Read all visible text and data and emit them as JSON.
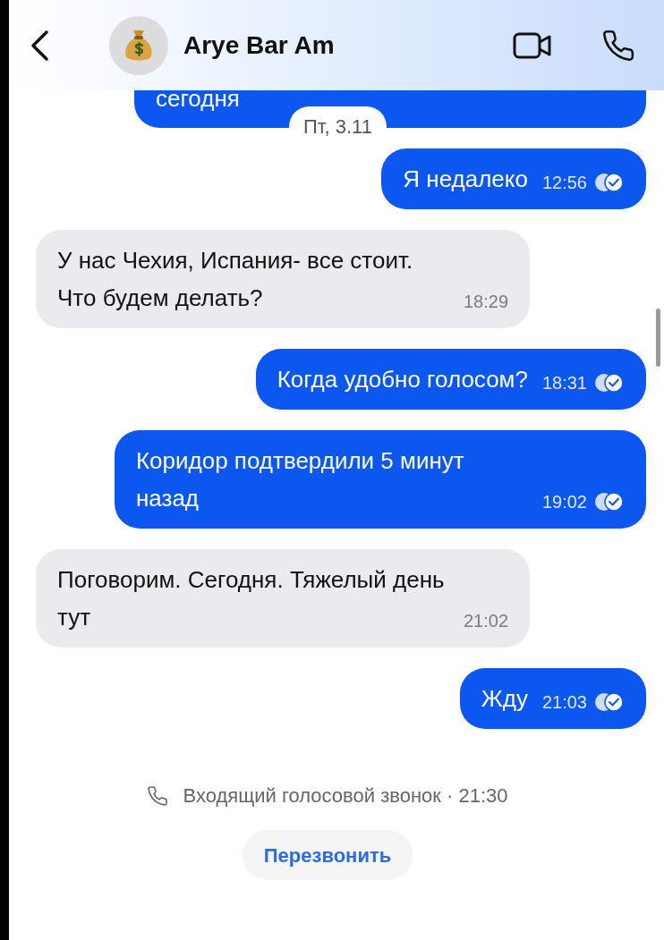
{
  "header": {
    "title": "Arye Bar Am"
  },
  "messages": [
    {
      "kind": "outgoing",
      "text": "сегодня",
      "clipped": true,
      "date_pill": "Пт, 3.11"
    },
    {
      "kind": "outgoing",
      "text": "Я недалеко",
      "time": "12:56",
      "read": true,
      "clipped": false
    },
    {
      "kind": "incoming",
      "text": "У нас Чехия, Испания- все стоит. Что будем делать?",
      "time": "18:29",
      "clipped": false
    },
    {
      "kind": "outgoing",
      "text": "Когда удобно голосом?",
      "time": "18:31",
      "read": true,
      "clipped": false
    },
    {
      "kind": "outgoing",
      "text": "Коридор подтвердили 5 минут назад",
      "time": "19:02",
      "read": true,
      "clipped": false
    },
    {
      "kind": "incoming",
      "text": "Поговорим. Сегодня. Тяжелый день тут",
      "time": "21:02",
      "clipped": false
    },
    {
      "kind": "outgoing",
      "text": "Жду",
      "time": "21:03",
      "read": true,
      "clipped": false
    }
  ],
  "call_event": {
    "text": "Входящий голосовой звонок · 21:30",
    "button": "Перезвонить"
  }
}
